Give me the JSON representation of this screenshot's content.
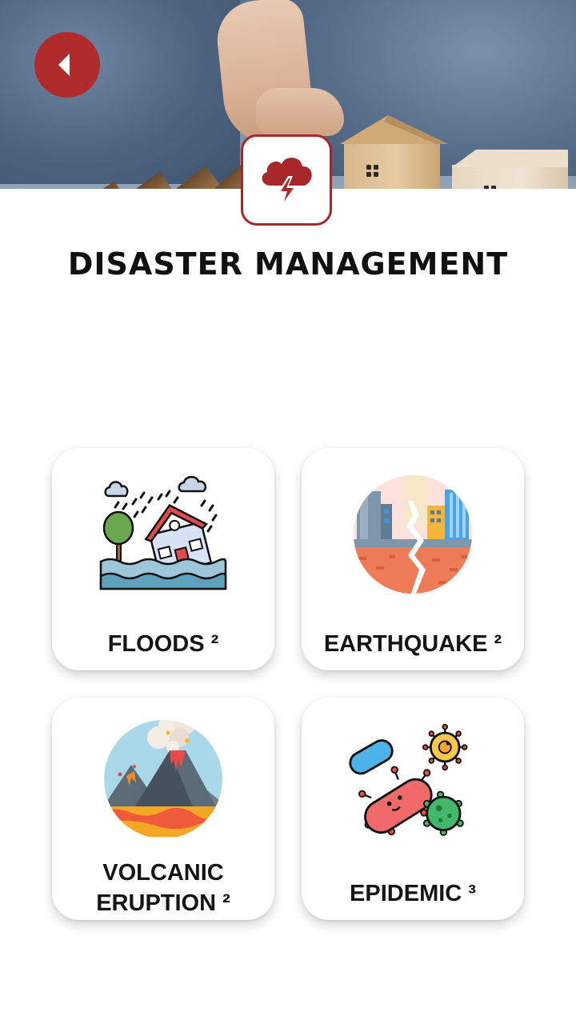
{
  "header": {
    "title": "DISASTER MANAGEMENT",
    "back_icon": "back-arrow-icon",
    "logo_icon": "storm-cloud-lightning-icon",
    "accent_color": "#a8272b"
  },
  "categories": [
    {
      "label": "FLOODS ²",
      "icon": "flood-house-icon"
    },
    {
      "label": "EARTHQUAKE ²",
      "icon": "earthquake-city-icon"
    },
    {
      "label_line1": "VOLCANIC",
      "label_line2": "ERUPTION ²",
      "icon": "volcano-icon"
    },
    {
      "label": "EPIDEMIC ³",
      "icon": "virus-bacteria-icon"
    }
  ]
}
